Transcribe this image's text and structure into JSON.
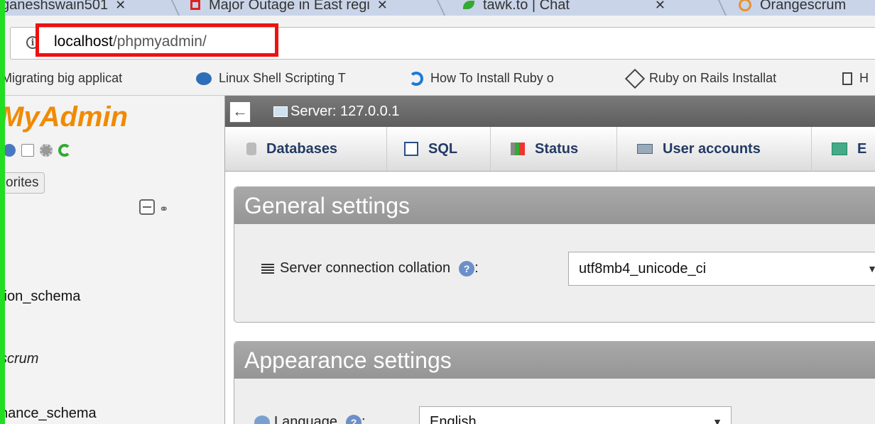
{
  "browser": {
    "tabs": [
      {
        "label": "ganeshswain501",
        "icon": "generic-tab-icon"
      },
      {
        "label": "Major Outage in East regi",
        "icon": "red-square-icon"
      },
      {
        "label": "tawk.to | Chat",
        "icon": "leaf-icon"
      },
      {
        "label": "Orangescrum",
        "icon": "orange-circle-icon"
      }
    ],
    "url_host": "localhost",
    "url_path": "/phpmyadmin/",
    "bookmarks": [
      {
        "label": "Migrating big applicat",
        "icon": ""
      },
      {
        "label": "Linux Shell Scripting T",
        "icon": "linux-icon"
      },
      {
        "label": "How To Install Ruby o",
        "icon": "digitalocean-icon"
      },
      {
        "label": "Ruby on Rails Installat",
        "icon": "rails-icon"
      },
      {
        "label": "H",
        "icon": "page-icon"
      }
    ]
  },
  "sidebar": {
    "logo": "MyAdmin",
    "favorites_label": "orites",
    "databases": [
      {
        "name": "tion_schema",
        "italic": false
      },
      {
        "name": "scrum",
        "italic": true
      },
      {
        "name": "nance_schema",
        "italic": false
      }
    ]
  },
  "main": {
    "server_label": "Server: 127.0.0.1",
    "back_symbol": "←",
    "tabs": [
      {
        "label": "Databases",
        "icon": "database-icon"
      },
      {
        "label": "SQL",
        "icon": "sql-icon"
      },
      {
        "label": "Status",
        "icon": "status-icon"
      },
      {
        "label": "User accounts",
        "icon": "users-icon"
      },
      {
        "label": "E",
        "icon": "export-icon"
      }
    ],
    "general_settings": {
      "title": "General settings",
      "collation_label": "Server connection collation",
      "collation_value": "utf8mb4_unicode_ci"
    },
    "appearance_settings": {
      "title": "Appearance settings",
      "language_label": "Language",
      "language_value": "English"
    }
  },
  "colors": {
    "accent_highlight": "#ee1111",
    "logo": "#f08a00",
    "tab_text": "#233a63",
    "left_marker": "#22dd22"
  }
}
